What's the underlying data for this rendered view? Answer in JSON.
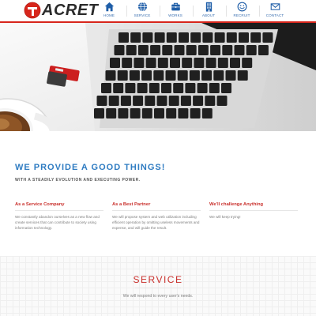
{
  "brand": {
    "name": "ACRET",
    "accent": "#d7261c",
    "nav_color": "#1f5ea8"
  },
  "nav": [
    {
      "label": "HOME",
      "icon": "home-icon"
    },
    {
      "label": "SERVICE",
      "icon": "globe-icon"
    },
    {
      "label": "WORKS",
      "icon": "briefcase-icon"
    },
    {
      "label": "ABOUT",
      "icon": "building-icon"
    },
    {
      "label": "RECRUIT",
      "icon": "smiley-icon"
    },
    {
      "label": "CONTACT",
      "icon": "envelope-icon"
    }
  ],
  "hero": {
    "image": "laptop keyboard, coffee cup and red usb drive"
  },
  "intro": {
    "title": "WE PROVIDE A GOOD THINGS!",
    "subtitle": "WITH A STEADILY EVOLUTION AND EXECUTING POWER.",
    "columns": [
      {
        "title": "As a Service Company",
        "text": "We constantly abandon ourselves as a new flow and create services that can contribute to society using information technology."
      },
      {
        "title": "As a Best Partner",
        "text": "We will propose system and web utilization including efficient operation by omitting useless movements and expense, and will guide the result."
      },
      {
        "title": "We'll challenge Anything",
        "text": "We will keep trying!"
      }
    ]
  },
  "service": {
    "title": "SERVICE",
    "subtitle": "We will respond to every user's needs."
  }
}
